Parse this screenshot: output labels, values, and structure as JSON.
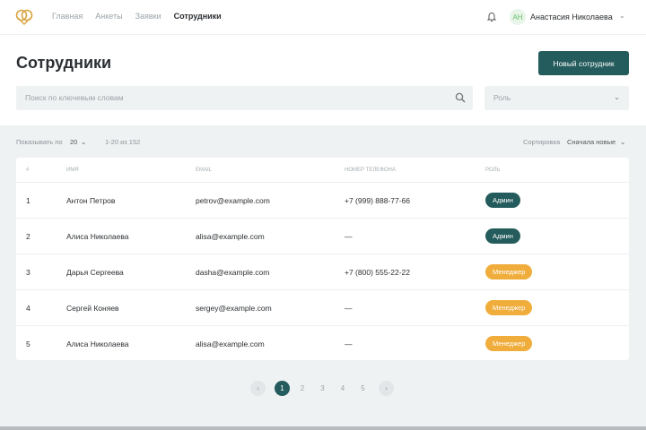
{
  "nav": {
    "links": [
      "Главная",
      "Анкеты",
      "Заявки",
      "Сотрудники"
    ],
    "active": 3
  },
  "user": {
    "initials": "АН",
    "name": "Анастасия Николаева"
  },
  "page": {
    "title": "Сотрудники",
    "new_button": "Новый сотрудник"
  },
  "search": {
    "placeholder": "Поиск по ключевым словам"
  },
  "role_filter": {
    "placeholder": "Роль"
  },
  "list_meta": {
    "show_label": "Показывать по",
    "per_page": "20",
    "range": "1-20 из 152",
    "sort_label": "Сортировка",
    "sort_value": "Сначала новые"
  },
  "table": {
    "headers": [
      "#",
      "ИМЯ",
      "EMAIL",
      "НОМЕР ТЕЛЕФОНА",
      "РОЛЬ"
    ],
    "rows": [
      [
        "1",
        "Антон Петров",
        "petrov@example.com",
        "+7 (999) 888-77-66",
        "Админ"
      ],
      [
        "2",
        "Алиса Николаева",
        "alisa@example.com",
        "—",
        "Админ"
      ],
      [
        "3",
        "Дарья Сергеева",
        "dasha@example.com",
        "+7 (800) 555-22-22",
        "Менеджер"
      ],
      [
        "4",
        "Сергей Коняев",
        "sergey@example.com",
        "—",
        "Менеджер"
      ],
      [
        "5",
        "Алиса Николаева",
        "alisa@example.com",
        "—",
        "Менеджер"
      ]
    ]
  },
  "pagination": {
    "pages": [
      "1",
      "2",
      "3",
      "4",
      "5"
    ],
    "current": "1",
    "prev": "‹",
    "next": "›"
  },
  "colors": {
    "primary": "#245b5c",
    "admin": "#245b5c",
    "manager": "#f0ad3c"
  }
}
